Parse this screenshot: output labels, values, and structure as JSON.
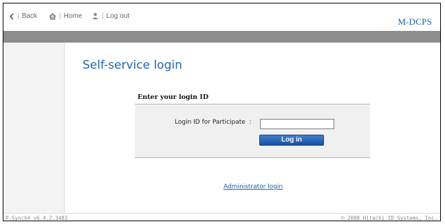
{
  "nav": {
    "back_label": "Back",
    "home_label": "Home",
    "logout_label": "Log out",
    "brand": "M-DCPS"
  },
  "page": {
    "title": "Self-service login"
  },
  "login": {
    "heading": "Enter your login ID",
    "field_label": "Login ID for Participate  :",
    "input_value": "",
    "button_label": "Log in"
  },
  "links": {
    "admin_login": "Administrator login"
  },
  "footer": {
    "version": "P-Synch® v6.4.2.3483",
    "copyright": "© 2008 Hitachi ID Systems, Inc."
  },
  "colors": {
    "accent": "#1f66b0",
    "button": "#1a4f9f",
    "grey_bar": "#8c8c8c"
  }
}
